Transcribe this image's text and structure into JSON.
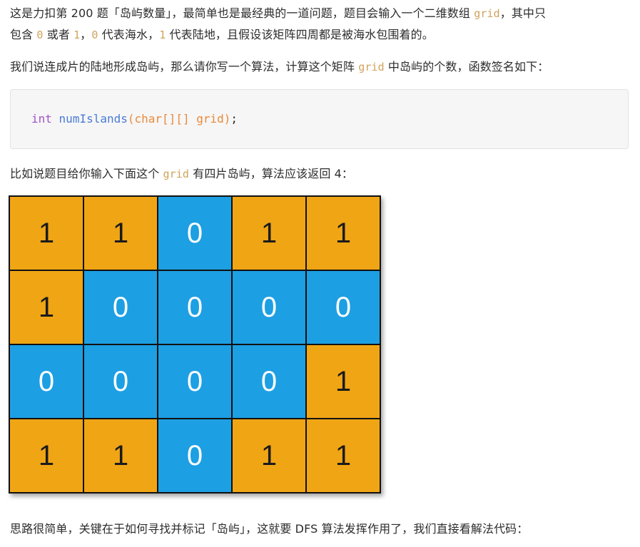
{
  "p1": {
    "a": "这是力扣第 200 题「岛屿数量」，最简单也是最经典的一道问题，题目会输入一个二维数组 ",
    "code_grid": "grid",
    "b": "，其中只",
    "c": "包含 ",
    "code_0": "0",
    "d": " 或者 ",
    "code_1": "1",
    "e": "，",
    "code_0b": "0",
    "f": " 代表海水，",
    "code_1b": "1",
    "g": " 代表陆地，且假设该矩阵四周都是被海水包围着的。"
  },
  "p2": {
    "a": "我们说连成片的陆地形成岛屿，那么请你写一个算法，计算这个矩阵 ",
    "code_grid": "grid",
    "b": " 中岛屿的个数，函数签名如下："
  },
  "code": {
    "kw_int": "int",
    "fn_name": "numIslands",
    "paren_open": "(",
    "kw_char": "char",
    "brackets": "[][]",
    "arg": "grid",
    "paren_close": ")",
    "semi": ";"
  },
  "p3": {
    "a": "比如说题目给你输入下面这个 ",
    "code_grid": "grid",
    "b": " 有四片岛屿，算法应该返回 4："
  },
  "p4": {
    "a": "思路很简单，关键在于如何寻找并标记「岛屿」，这就要 DFS 算法发挥作用了，我们直接看解法代码："
  },
  "grid": {
    "rows": [
      [
        "1",
        "1",
        "0",
        "1",
        "1"
      ],
      [
        "1",
        "0",
        "0",
        "0",
        "0"
      ],
      [
        "0",
        "0",
        "0",
        "0",
        "1"
      ],
      [
        "1",
        "1",
        "0",
        "1",
        "1"
      ]
    ],
    "colors": {
      "land": "#f0a515",
      "water": "#1d9fe3"
    }
  }
}
